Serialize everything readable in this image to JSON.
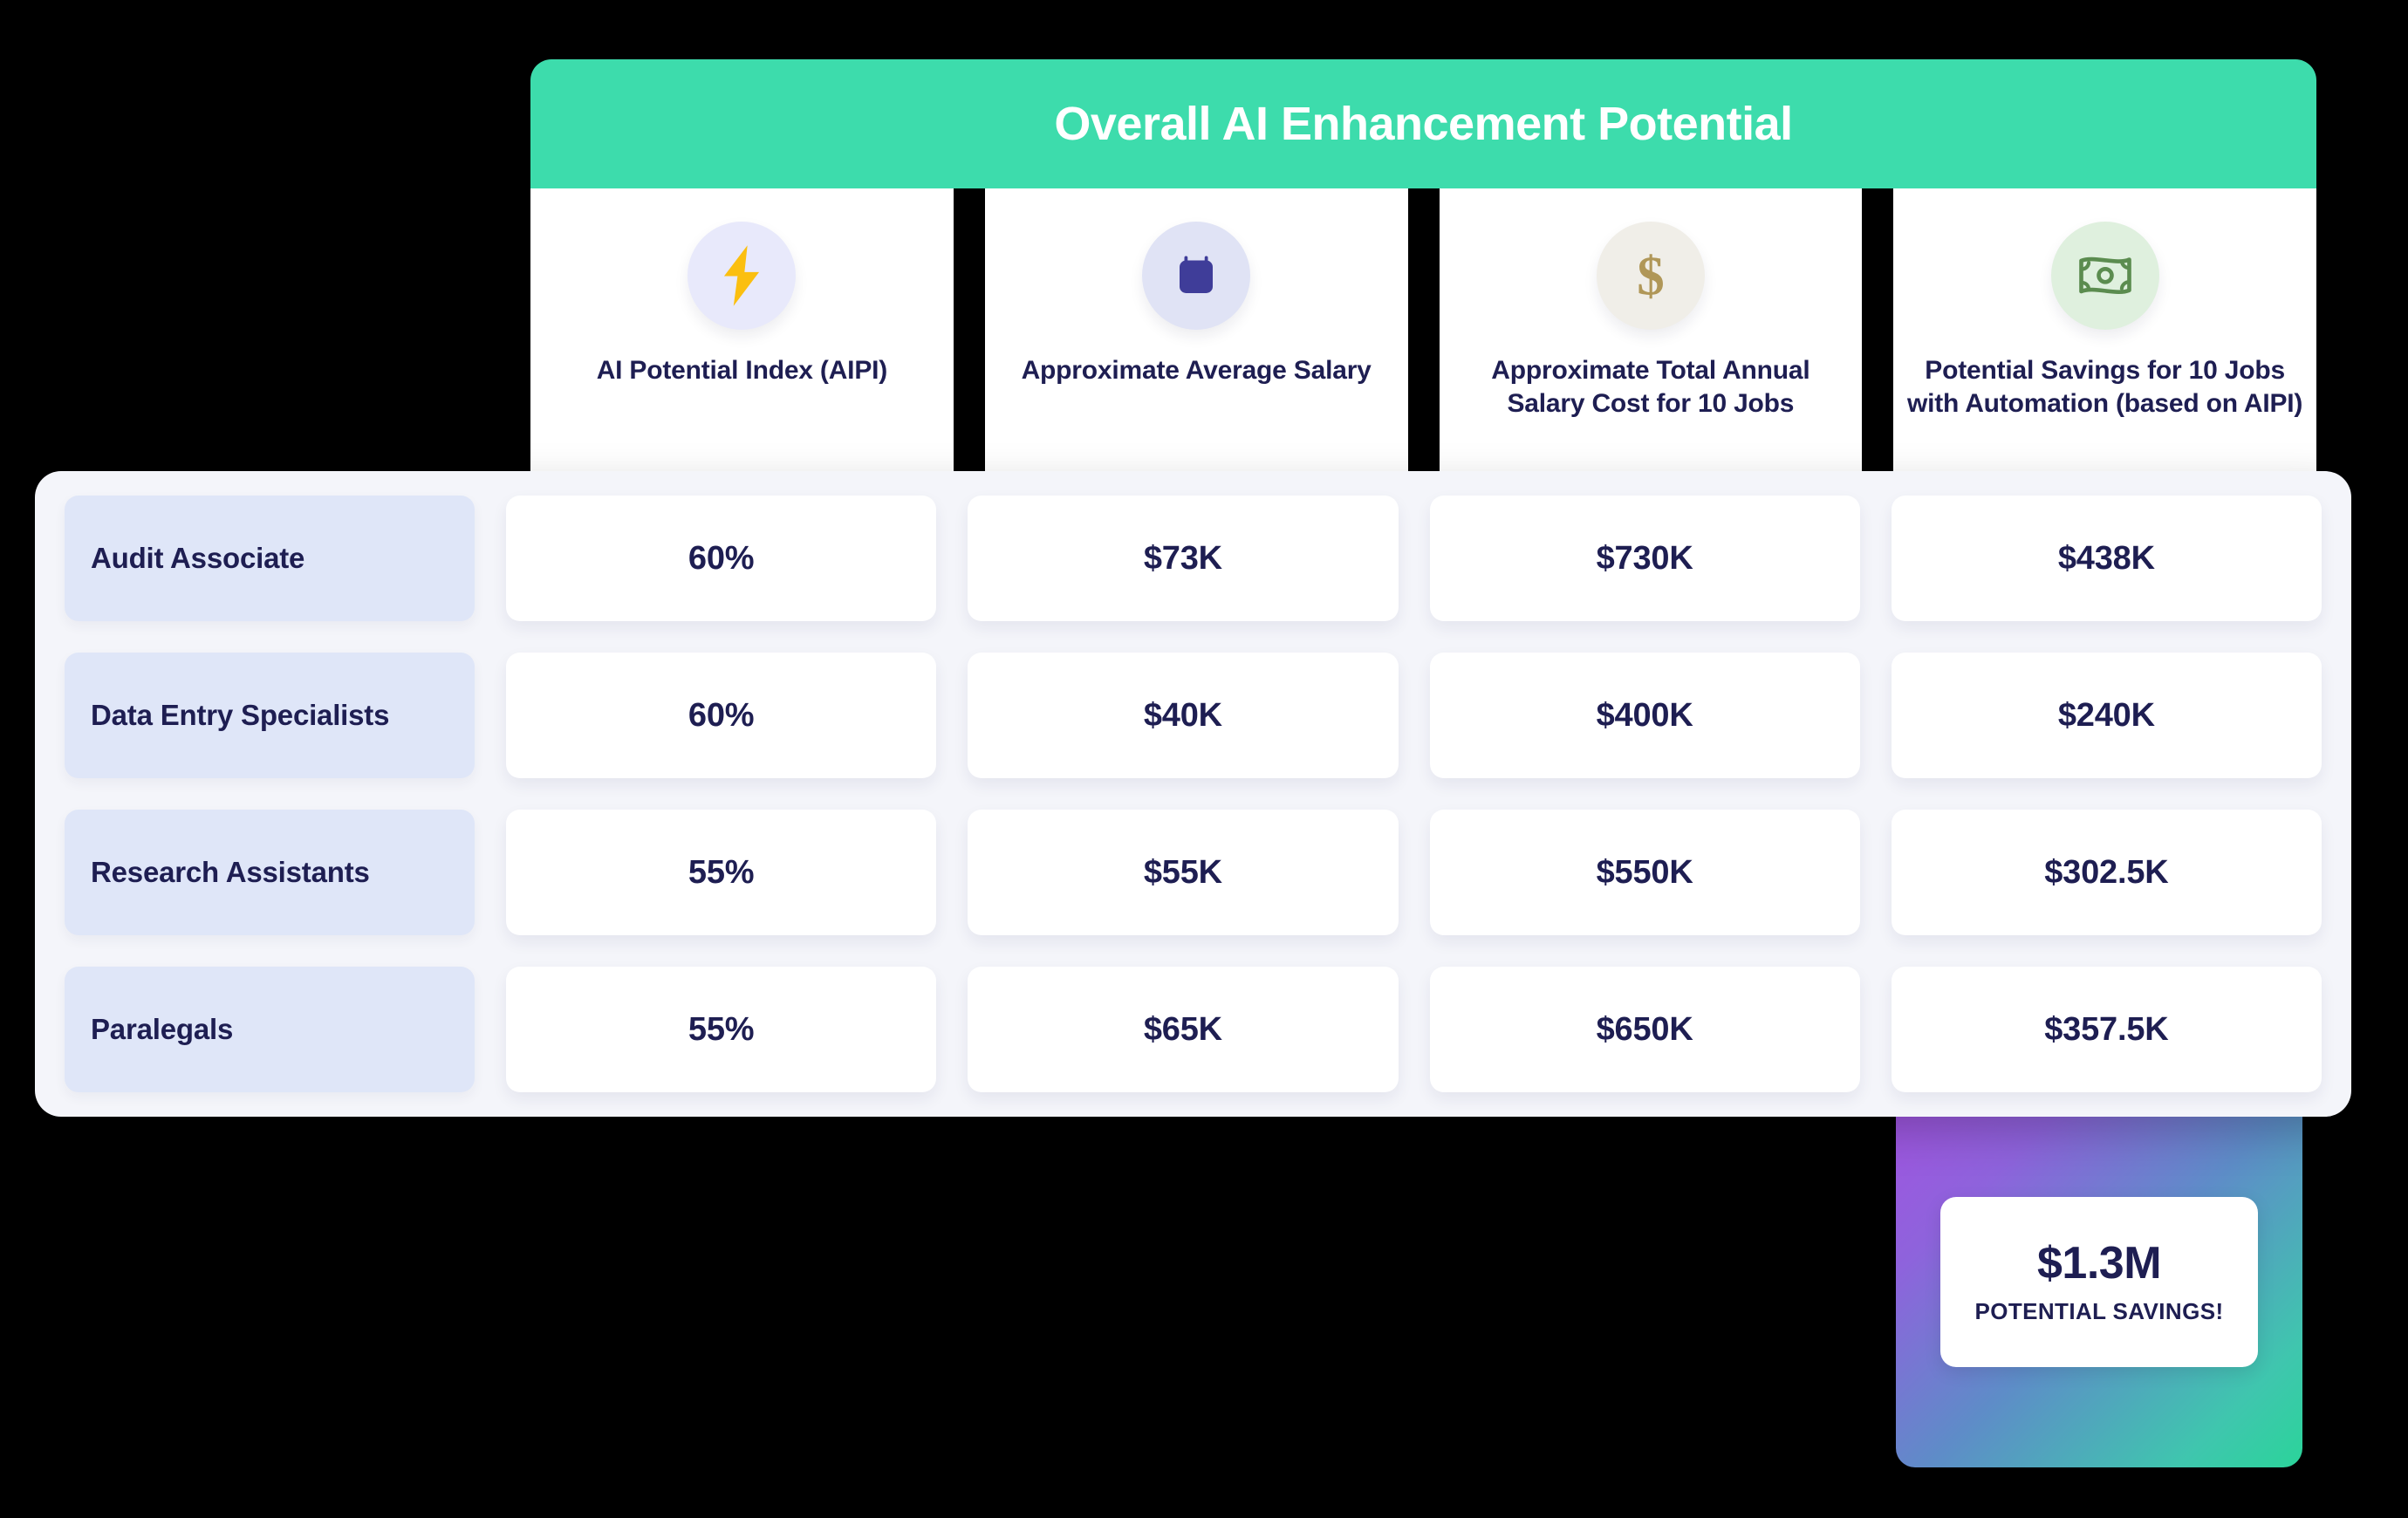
{
  "header": {
    "title": "Overall AI Enhancement Potential",
    "background_color": "#3DDCAC",
    "text_color": "#FFFFFF"
  },
  "columns": [
    {
      "label": "AI Potential Index (AIPI)",
      "icon": "lightning-bolt-icon",
      "icon_color": "#FBBF10",
      "circle_color": "#E8E9FB"
    },
    {
      "label": "Approximate Average Salary",
      "icon": "briefcase-icon",
      "icon_color": "#3F3D99",
      "circle_color": "#E0E3F5"
    },
    {
      "label": "Approximate Total Annual Salary Cost for 10 Jobs",
      "icon": "dollar-sign-icon",
      "icon_color": "#B09758",
      "circle_color": "#F0EEE8"
    },
    {
      "label": "Potential Savings for 10 Jobs with Automation (based on AIPI)",
      "icon": "banknote-icon",
      "icon_color": "#5B8C4F",
      "circle_color": "#DFF0DE"
    }
  ],
  "rows": [
    {
      "role": "Audit Associate",
      "aipi": "60%",
      "avg_salary": "$73K",
      "total_annual_cost": "$730K",
      "potential_savings": "$438K"
    },
    {
      "role": "Data Entry Specialists",
      "aipi": "60%",
      "avg_salary": "$40K",
      "total_annual_cost": "$400K",
      "potential_savings": "$240K"
    },
    {
      "role": "Research Assistants",
      "aipi": "55%",
      "avg_salary": "$55K",
      "total_annual_cost": "$550K",
      "potential_savings": "$302.5K"
    },
    {
      "role": "Paralegals",
      "aipi": "55%",
      "avg_salary": "$65K",
      "total_annual_cost": "$650K",
      "potential_savings": "$357.5K"
    }
  ],
  "savings_badge": {
    "amount": "$1.3M",
    "caption": "POTENTIAL SAVINGS!",
    "gradient_start": "#A74FE2",
    "gradient_mid": "#5E8CC8",
    "gradient_end": "#2BD49A"
  },
  "palette": {
    "text_navy": "#1E1E52",
    "row_chip": "#DFE6F8",
    "panel_bg": "#F4F5FA",
    "cell_bg": "#FFFFFF"
  }
}
